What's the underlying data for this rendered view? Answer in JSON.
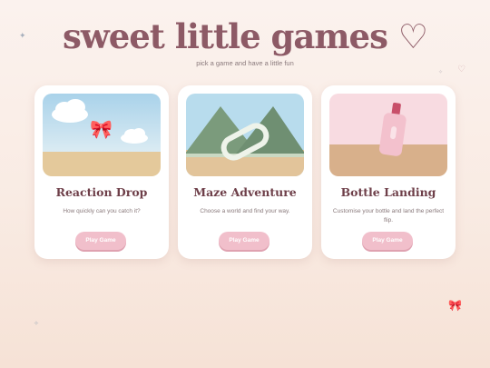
{
  "header": {
    "title": "sweet little games ♡",
    "subtitle": "pick a game and have a little fun"
  },
  "decorations": {
    "sparkle": "✦",
    "heart": "♡",
    "small_sparkle": "✧",
    "bow": "🎀"
  },
  "games": [
    {
      "title": "Reaction Drop",
      "description": "How quickly can you catch it?",
      "button_label": "Play Game",
      "icon": "bow-icon",
      "bow": "🎀"
    },
    {
      "title": "Maze Adventure",
      "description": "Choose a world and find your way.",
      "button_label": "Play Game",
      "icon": "maze-icon"
    },
    {
      "title": "Bottle Landing",
      "description": "Customise your bottle and land the perfect flip.",
      "button_label": "Play Game",
      "icon": "bottle-icon"
    }
  ],
  "colors": {
    "title": "#8d5a66",
    "button": "#f1bfcb",
    "card_title": "#6e3f49",
    "background": "#fbf2ee"
  }
}
